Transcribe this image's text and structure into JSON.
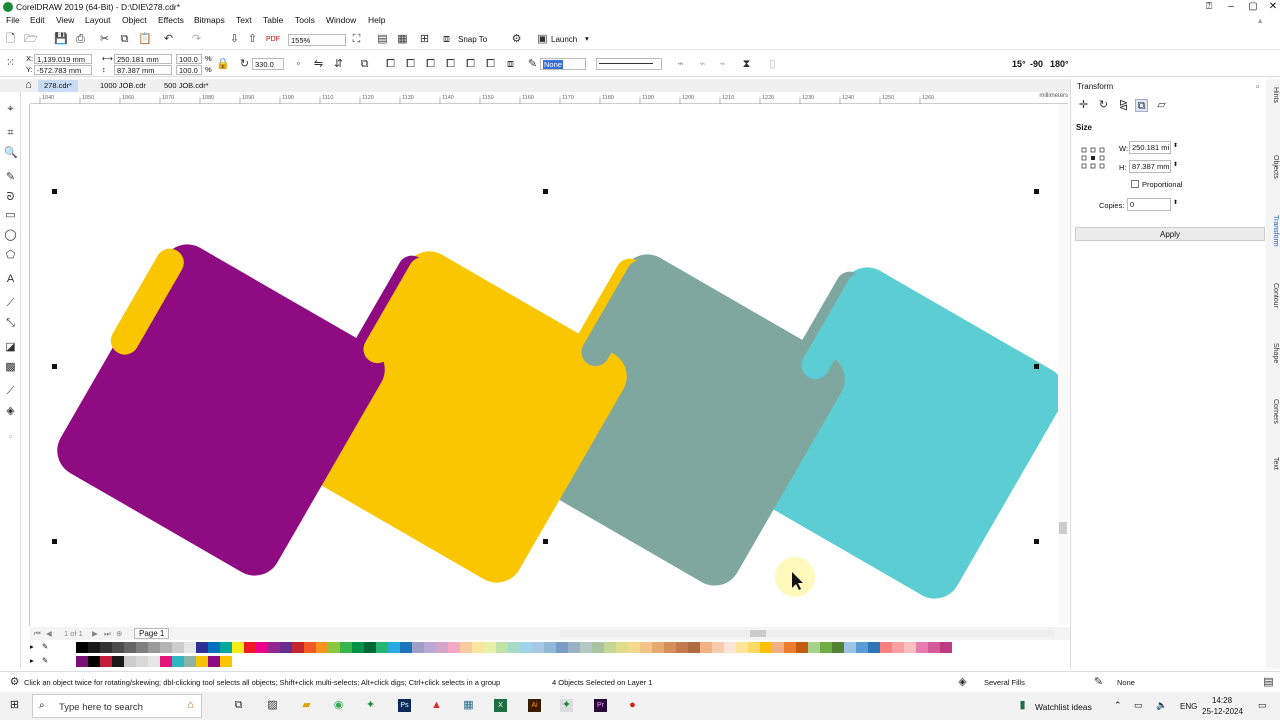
{
  "window": {
    "title": "CorelDRAW 2019 (64-Bit) - D:\\DIE\\278.cdr*"
  },
  "menu": [
    "File",
    "Edit",
    "View",
    "Layout",
    "Object",
    "Effects",
    "Bitmaps",
    "Text",
    "Table",
    "Tools",
    "Window",
    "Help"
  ],
  "toolbar": {
    "zoom": "155%",
    "snap_to": "Snap To",
    "launch": "Launch"
  },
  "properties": {
    "x": "1,139.019 mm",
    "y": "-572.783 mm",
    "width": "250.181 mm",
    "height": "87.387 mm",
    "scale_w": "100.0",
    "scale_h": "100.0",
    "percent": "%",
    "rotation": "330.0",
    "outline_none": "None",
    "angle_15": "15°",
    "angle_90": "-90",
    "angle_180": "180°"
  },
  "doc_tabs": [
    "278.cdr*",
    "1000 JOB.cdr",
    "500 JOB.cdr*"
  ],
  "ruler": {
    "ticks": [
      "1040",
      "1050",
      "1060",
      "1070",
      "1080",
      "1090",
      "1100",
      "1110",
      "1120",
      "1130",
      "1140",
      "1150",
      "1160",
      "1170",
      "1180",
      "1190",
      "1200",
      "1210",
      "1220",
      "1230",
      "1240",
      "1250",
      "1260"
    ],
    "unit": "millimeters"
  },
  "pagebar": {
    "count": "1 of 1",
    "page": "Page 1"
  },
  "status": {
    "hint": "Click an object twice for rotating/skewing; dbl-clicking tool selects all objects; Shift+click multi-selects; Alt+click digs; Ctrl+click selects in a group",
    "selection": "4 Objects Selected on Layer 1",
    "fill": "Several Fills",
    "outline": "None"
  },
  "transform": {
    "title": "Transform",
    "section": "Size",
    "w_label": "W:",
    "w_value": "250.181 mi",
    "h_label": "H:",
    "h_value": "87.387 mm",
    "proportional": "Proportional",
    "copies_label": "Copies:",
    "copies_value": "0",
    "apply": "Apply"
  },
  "docker_tabs": [
    "Hints",
    "Objects",
    "Transform",
    "Contour",
    "Shape",
    "Corners",
    "Text"
  ],
  "taskbar": {
    "search_placeholder": "Type here to search",
    "weather": "Watchlist ideas",
    "lang": "ENG",
    "time": "14:28",
    "date": "25-12-2024"
  },
  "shapes": [
    {
      "name": "purple-shape",
      "color": "#8e0b82"
    },
    {
      "name": "yellow-shape",
      "color": "#f9c600"
    },
    {
      "name": "gray-shape",
      "color": "#7fa7a0"
    },
    {
      "name": "cyan-shape",
      "color": "#5ccdd3"
    }
  ],
  "palette_row1": [
    "#ffffff",
    "#000000",
    "#1a1a1a",
    "#333333",
    "#4d4d4d",
    "#666666",
    "#808080",
    "#999999",
    "#b3b3b3",
    "#cccccc",
    "#e6e6e6",
    "#2e3192",
    "#0071bc",
    "#00a99d",
    "#f7ec13",
    "#ed1c24",
    "#ec008c",
    "#92278f",
    "#662d91",
    "#c1272d",
    "#f15a24",
    "#f7931e",
    "#8cc63f",
    "#39b54a",
    "#009245",
    "#006837",
    "#22b573",
    "#29abe2",
    "#1b75bc",
    "#9e9ec7",
    "#b8a9d9",
    "#d4a5c9",
    "#f4a9c4",
    "#f9c9a0",
    "#fbe3a0",
    "#e8f1a5",
    "#c2e3a8",
    "#a7dbc8",
    "#9fd4e8",
    "#a8c8e8",
    "#8fb9d6",
    "#7a9cc6",
    "#9bb1c4",
    "#b4c8c4",
    "#a9c4a0",
    "#c6d694",
    "#e0dc8c",
    "#f2d98c",
    "#f2c48c",
    "#e6a96e",
    "#d68f5c",
    "#c47a4e",
    "#b06a42",
    "#f4b183",
    "#f8cbad",
    "#fbe5d6",
    "#ffe699",
    "#ffd966",
    "#ffc000",
    "#f4b084",
    "#ed7d31",
    "#c55a11",
    "#a9d18e",
    "#70ad47",
    "#548235",
    "#9dc3e6",
    "#5b9bd5",
    "#2e75b6",
    "#ff7f7f",
    "#ff9f9f",
    "#ffbfbf",
    "#e87bb0",
    "#d45a9a",
    "#bf3a84"
  ],
  "palette_row2": [
    "#ffffff",
    "#7a0f78",
    "#000000",
    "#c41e3a",
    "#1a1a1a",
    "#cccccc",
    "#d9d9d9",
    "#e6e6e6",
    "#e4147c",
    "#2db7c2",
    "#8fb2a8",
    "#f6c200",
    "#8e0b82",
    "#f9c600"
  ]
}
